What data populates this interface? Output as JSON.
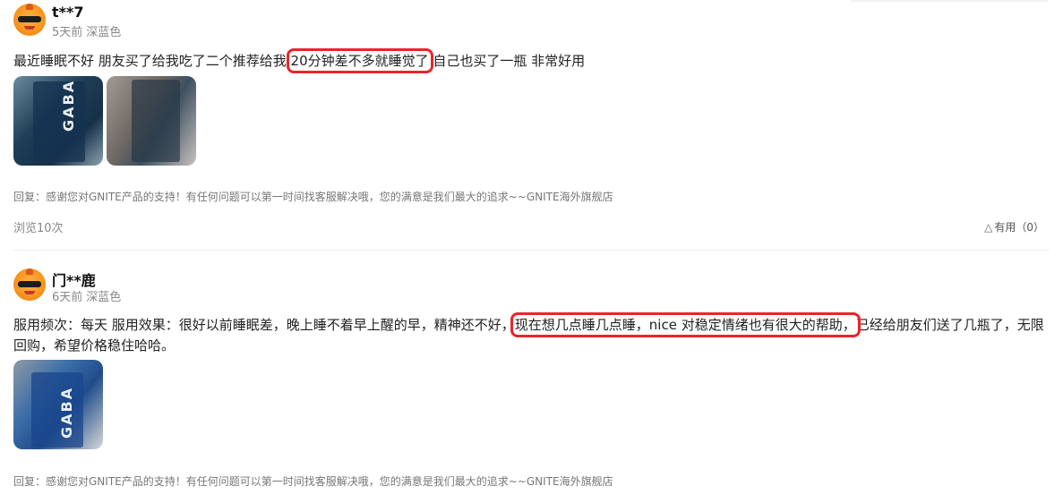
{
  "reviews": [
    {
      "username": "t**7",
      "time": "5天前",
      "variant": "深蓝色",
      "text_before": "最近睡眠不好 朋友买了给我吃了二个推荐给我 ",
      "text_highlight": "20分钟差不多就睡觉了",
      "text_after": " 自己也买了一瓶 非常好用",
      "photos": [
        {
          "label": "GABA"
        },
        {
          "label": ""
        }
      ],
      "reply": "回复：感谢您对GNITE产品的支持！有任何问题可以第一时间找客服解决哦，您的满意是我们最大的追求~~GNITE海外旗舰店",
      "views": "浏览10次",
      "helpful": "有用（0）"
    },
    {
      "username": "门**鹿",
      "time": "6天前",
      "variant": "深蓝色",
      "text_before": "服用频次：每天 服用效果：很好以前睡眠差，晚上睡不着早上醒的早，精神还不好，",
      "text_highlight": "现在想几点睡几点睡，nice 对稳定情绪也有很大的帮助，",
      "text_after": "已经给朋友们送了几瓶了，无限回购，希望价格稳住哈哈。",
      "photos": [
        {
          "label": "GABA"
        }
      ],
      "reply": "回复：感谢您对GNITE产品的支持！有任何问题可以第一时间找客服解决哦，您的满意是我们最大的追求~~GNITE海外旗舰店"
    }
  ],
  "colors": {
    "highlight_box": "#e8262a",
    "meta_gray": "#888888",
    "avatar_orange": "#f7941d"
  },
  "icons": {
    "helpful": "triangle-up-outline-icon",
    "avatar": "cartoon-duck-sunglasses-icon"
  }
}
